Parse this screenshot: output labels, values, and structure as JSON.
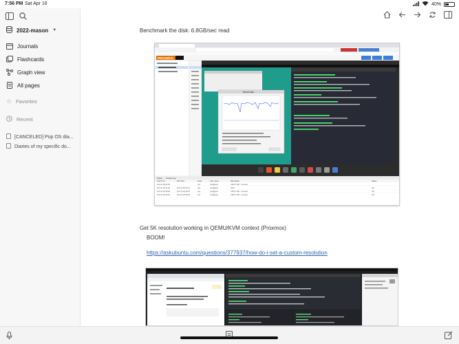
{
  "status_bar": {
    "time": "7:56 PM",
    "date": "Sat Apr 16",
    "battery": "40%",
    "battery_level": 0.4
  },
  "sidebar": {
    "graph_name": "2022-mason",
    "nav": [
      {
        "label": "Journals",
        "icon": "calendar-icon"
      },
      {
        "label": "Flashcards",
        "icon": "cards-icon"
      },
      {
        "label": "Graph view",
        "icon": "graph-icon"
      },
      {
        "label": "All pages",
        "icon": "pages-icon"
      }
    ],
    "favorites_label": "Favorites",
    "recent_label": "Recent",
    "recent": [
      "[CANCELED] Pop OS dia...",
      "Diaries of my specific do..."
    ]
  },
  "content": {
    "block1": "Benchmark the disk: 6.8GB/sec read",
    "block2": "Get 5K resolution working in QEMU/KVM context (Proxmox)",
    "block3": "BOOM!",
    "link": "https://askubuntu.com/questions/377937/how-do-i-set-a-custom-resolution"
  },
  "screenshot1": {
    "proxmox_logo": "PROXMOX",
    "dialog_title": "Benchmark",
    "tasks_header": [
      "Start Time",
      "End Time",
      "Node",
      "User name",
      "Description",
      "Status"
    ],
    "tasks": [
      [
        "Feb 16 18:22:26",
        "",
        "pve",
        "root@pam",
        "VM/CT 100 - Console",
        ""
      ],
      [
        "Feb 16 18:21:20",
        "Feb 16 18:21:21",
        "pve",
        "root@pam",
        "Shell",
        "OK"
      ],
      [
        "Feb 16 18:18:38",
        "Feb 16 18:19:20",
        "pve",
        "root@pam",
        "VM/CT 100 - Console",
        "OK"
      ],
      [
        "Feb 16 18:16:42",
        "Feb 16 18:18:33",
        "pve",
        "root@pam",
        "VM/CT 100 - Console",
        "OK"
      ]
    ],
    "tasks_tabs": [
      "Tasks",
      "Cluster log"
    ]
  }
}
